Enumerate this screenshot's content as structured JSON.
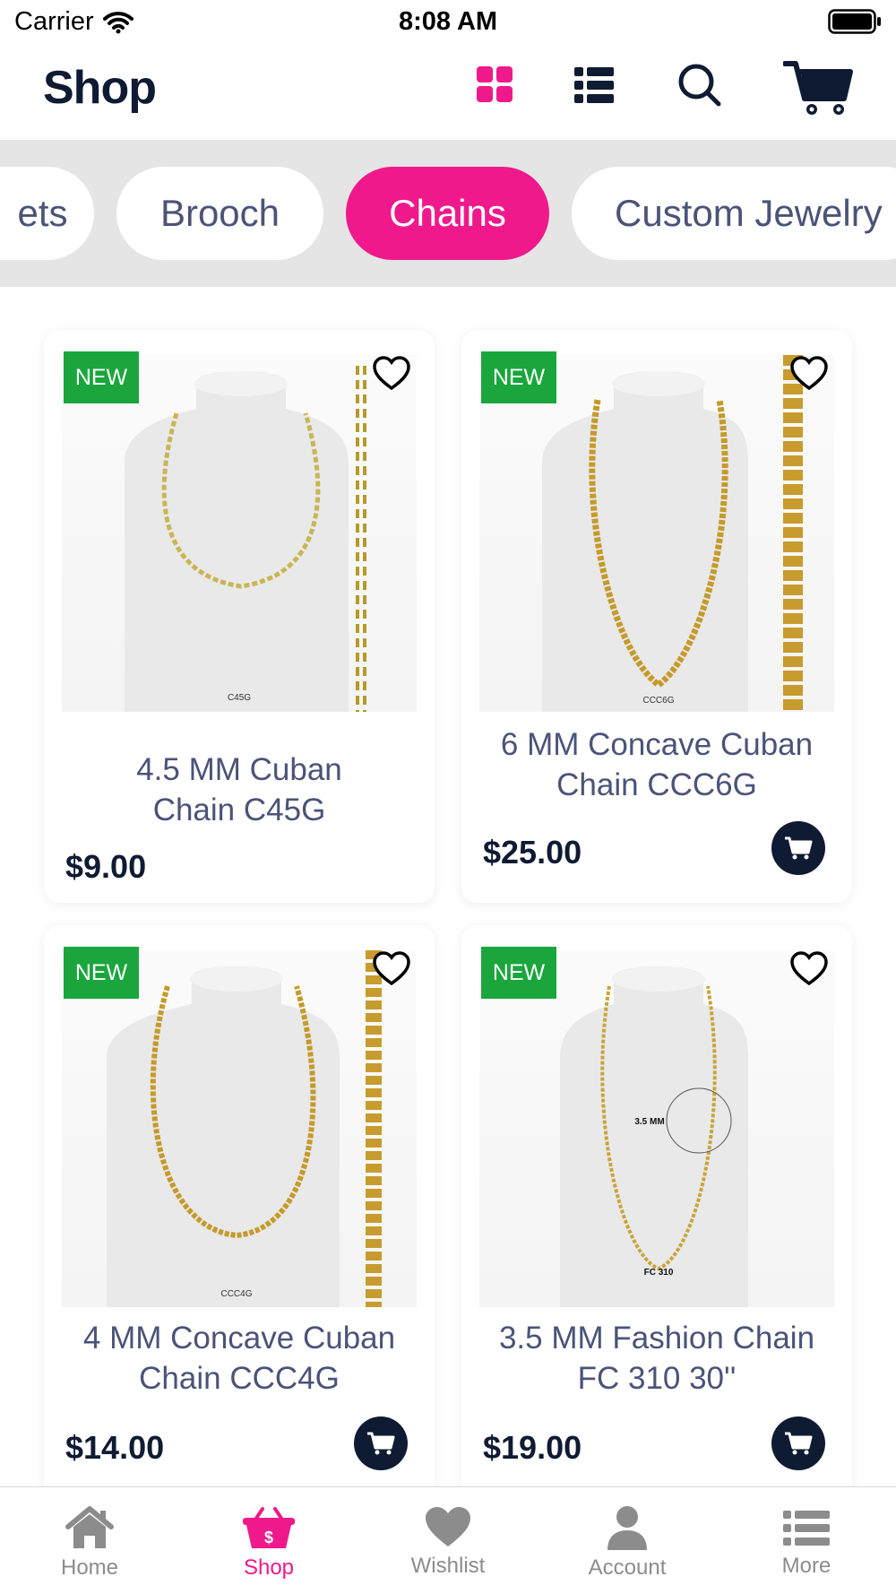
{
  "status_bar": {
    "carrier": "Carrier",
    "time": "8:08 AM"
  },
  "header": {
    "title": "Shop",
    "icons": [
      "grid-view-icon",
      "list-view-icon",
      "search-icon",
      "cart-icon"
    ]
  },
  "categories": [
    {
      "label": "ets",
      "active": false
    },
    {
      "label": "Brooch",
      "active": false
    },
    {
      "label": "Chains",
      "active": true
    },
    {
      "label": "Custom Jewelry",
      "active": false
    }
  ],
  "products": [
    {
      "badge": "NEW",
      "name_line1": "4.5 MM Cuban",
      "name_line2": "Chain C45G",
      "price": "$9.00",
      "image_tag": "C45G"
    },
    {
      "badge": "NEW",
      "name_line1": "6 MM Concave Cuban",
      "name_line2": "Chain CCC6G",
      "price": "$25.00",
      "image_tag": "CCC6G"
    },
    {
      "badge": "NEW",
      "name_line1": "4 MM Concave Cuban",
      "name_line2": "Chain CCC4G",
      "price": "$14.00",
      "image_tag": "CCC4G"
    },
    {
      "badge": "NEW",
      "name_line1": "3.5 MM Fashion Chain",
      "name_line2": "FC 310 30''",
      "price": "$19.00",
      "image_tag": "FC 310",
      "image_size_label": "3.5 MM"
    }
  ],
  "tabs": [
    {
      "label": "Home",
      "icon": "home-icon",
      "active": false
    },
    {
      "label": "Shop",
      "icon": "shop-basket-icon",
      "active": true
    },
    {
      "label": "Wishlist",
      "icon": "heart-icon",
      "active": false
    },
    {
      "label": "Account",
      "icon": "account-icon",
      "active": false
    },
    {
      "label": "More",
      "icon": "more-list-icon",
      "active": false
    }
  ],
  "colors": {
    "accent": "#f0198c",
    "navy": "#0f1b33",
    "badge_green": "#1aa63c",
    "chip_text": "#4b5378",
    "strip_bg": "#e5e5e5"
  }
}
